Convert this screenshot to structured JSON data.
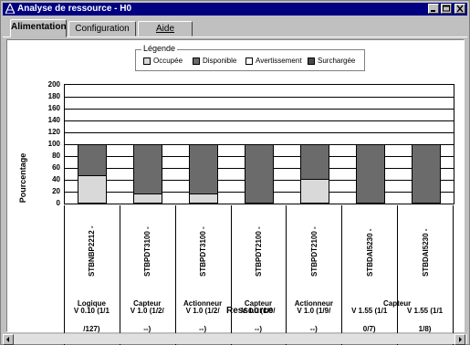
{
  "window": {
    "title": "Analyse de ressource - H0",
    "icon": "app-triangle-icon",
    "controls": [
      "minimize",
      "maximize",
      "close"
    ]
  },
  "tabs": [
    {
      "label": "Alimentation",
      "active": true
    },
    {
      "label": "Configuration",
      "active": false
    },
    {
      "label": "Aide",
      "active": false
    }
  ],
  "colors": {
    "occupee": "#d9d9d9",
    "disponible": "#6b6b6b",
    "avertissement": "#ffffff",
    "surchargee": "#4a4a4a"
  },
  "legend": {
    "title": "Légende",
    "items": [
      "Occupée",
      "Disponible",
      "Avertissement",
      "Surchargée"
    ]
  },
  "chart_data": {
    "type": "bar",
    "stacked": true,
    "ylabel": "Pourcentage",
    "xlabel": "Ressource",
    "ylim": [
      0,
      200
    ],
    "yticks": [
      "200",
      "180",
      "160",
      "140",
      "120",
      "100",
      "80",
      "60",
      "40",
      "20",
      "0"
    ],
    "grid": true,
    "legend_position": "top",
    "categories": [
      {
        "name": "STBNBP2212 -",
        "version_l1": "V 0.10 (1/1",
        "version_l2": "/127)"
      },
      {
        "name": "STBPDT3100 -",
        "version_l1": "V 1.0 (1/2/",
        "version_l2": "--)"
      },
      {
        "name": "STBPDT3100 -",
        "version_l1": "V 1.0 (1/2/",
        "version_l2": "--)"
      },
      {
        "name": "STBPDT2100 -",
        "version_l1": "V 1.0 (1/9/",
        "version_l2": "--)"
      },
      {
        "name": "STBPDT2100 -",
        "version_l1": "V 1.0 (1/9/",
        "version_l2": "--)"
      },
      {
        "name": "STBDAI5230 -",
        "version_l1": "V 1.55 (1/1",
        "version_l2": "0/7)"
      },
      {
        "name": "STBDAI5230 -",
        "version_l1": "V 1.55 (1/1",
        "version_l2": "1/8)"
      }
    ],
    "groups": [
      {
        "label": "Logique",
        "span": 1
      },
      {
        "label": "Capteur",
        "span": 1
      },
      {
        "label": "Actionneur",
        "span": 1
      },
      {
        "label": "Capteur",
        "span": 1
      },
      {
        "label": "Actionneur",
        "span": 1
      },
      {
        "label": "Capteur",
        "span": 2
      }
    ],
    "series": [
      {
        "name": "Occupée",
        "values": [
          47,
          16,
          16,
          0,
          41,
          0,
          0
        ]
      },
      {
        "name": "Disponible",
        "values": [
          53,
          84,
          84,
          100,
          59,
          100,
          100
        ]
      }
    ]
  }
}
